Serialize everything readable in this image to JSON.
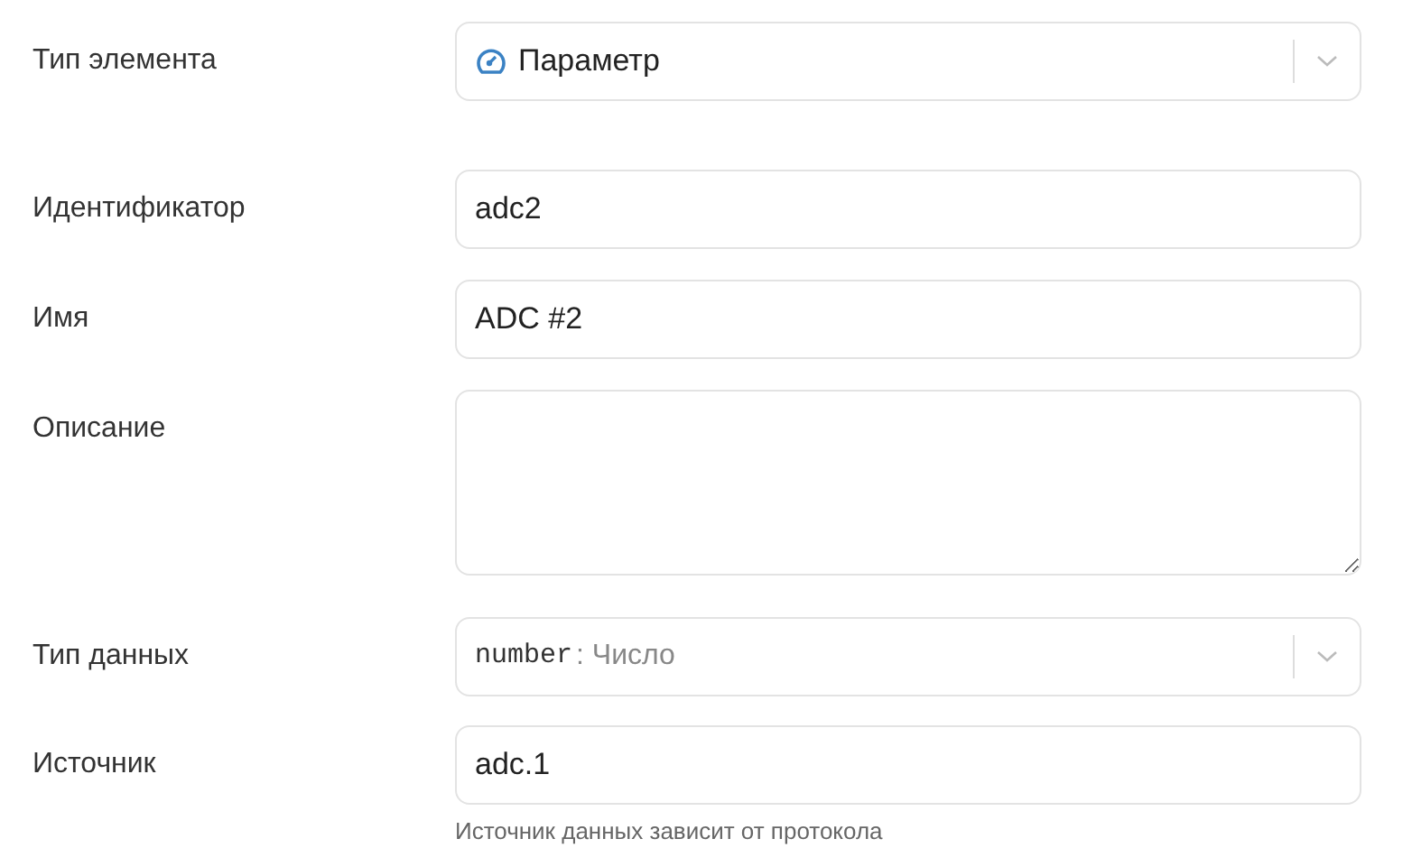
{
  "fields": [
    {
      "kind": "icon-select",
      "label": "Тип элемента",
      "value": "Параметр"
    },
    {
      "kind": "text",
      "label": "Идентификатор",
      "value": "adc2"
    },
    {
      "kind": "text",
      "label": "Имя",
      "value": "ADC #2"
    },
    {
      "kind": "textarea",
      "label": "Описание"
    },
    {
      "kind": "select",
      "label": "Тип данных",
      "code": "number",
      "value": ": Число"
    },
    {
      "kind": "text",
      "label": "Источник",
      "value": "adc.1",
      "help": "Источник данных зависит от протокола"
    }
  ]
}
